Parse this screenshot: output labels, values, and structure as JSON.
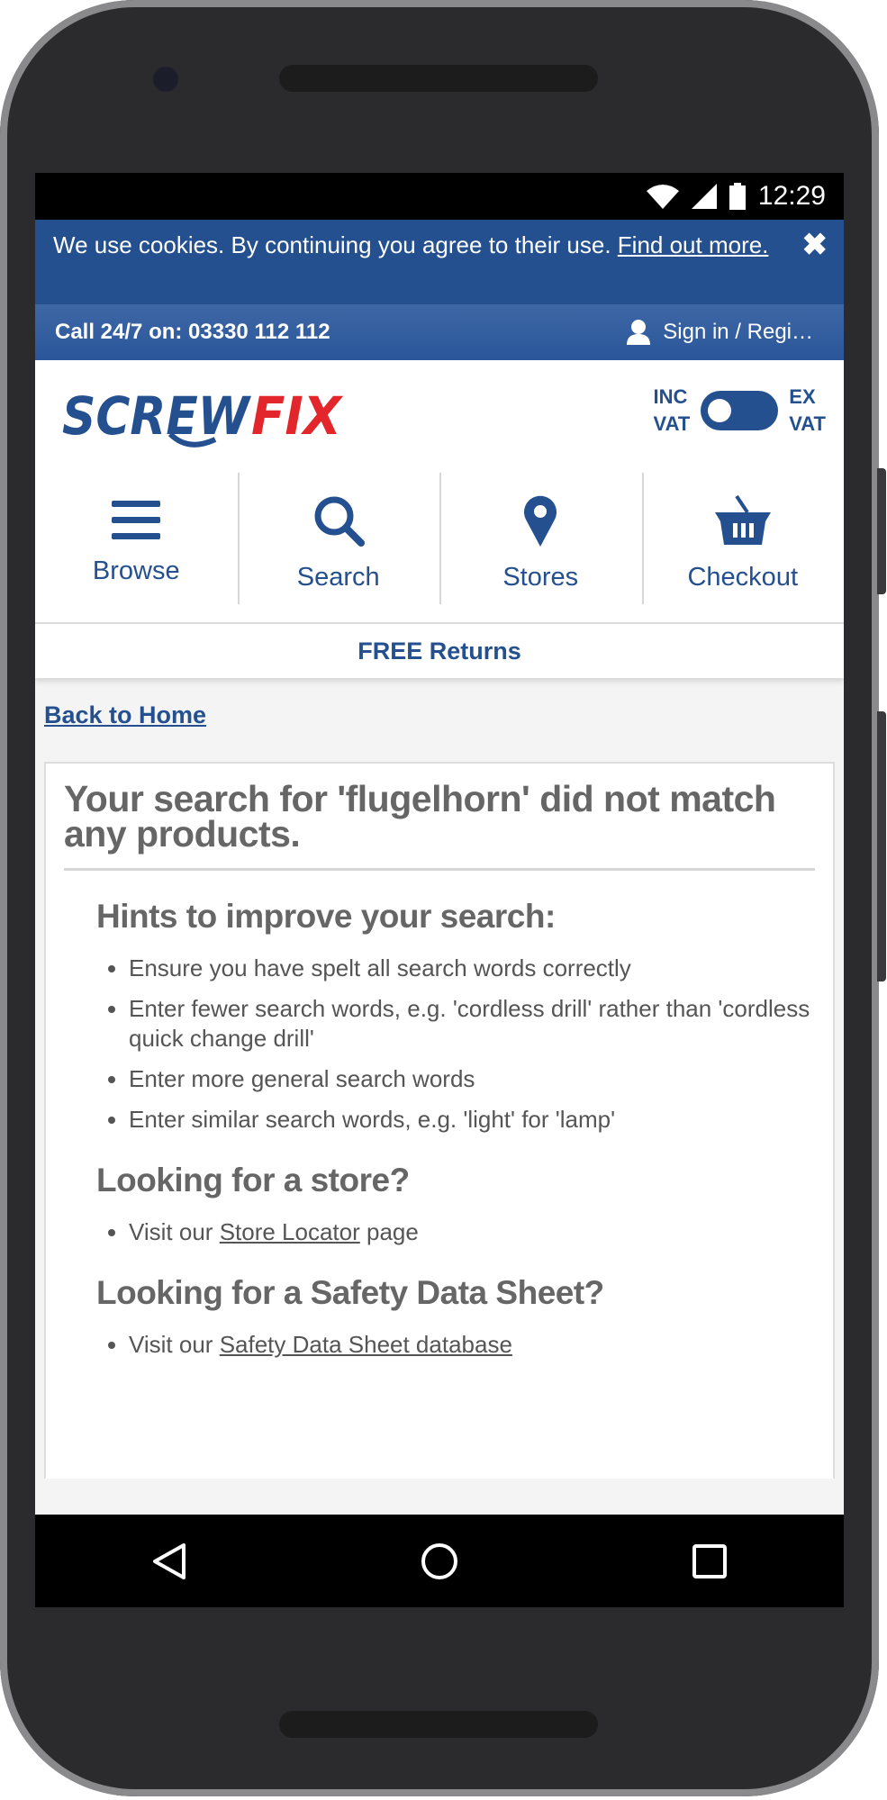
{
  "status_bar": {
    "time": "12:29"
  },
  "cookie_banner": {
    "text": "We use cookies. By continuing you agree to their use.",
    "link_text": "Find out more.",
    "close_glyph": "✖"
  },
  "call_bar": {
    "call_text": "Call 24/7 on: 03330 112 112",
    "sign_in_text": "Sign in / Regi…"
  },
  "header": {
    "logo_part1": "SCREW",
    "logo_part2": "FIX",
    "vat_inc_line1": "INC",
    "vat_inc_line2": "VAT",
    "vat_ex_line1": "EX",
    "vat_ex_line2": "VAT"
  },
  "nav": {
    "browse": "Browse",
    "search": "Search",
    "stores": "Stores",
    "checkout": "Checkout"
  },
  "promo": "FREE Returns",
  "main": {
    "back_link": "Back to Home",
    "no_results_title": "Your search for 'flugelhorn' did not match any products.",
    "hints_heading": "Hints to improve your search:",
    "hints": [
      "Ensure you have spelt all search words correctly",
      "Enter fewer search words, e.g. 'cordless drill' rather than 'cordless quick change drill'",
      "Enter more general search words",
      "Enter similar search words, e.g. 'light' for 'lamp'"
    ],
    "store_heading": "Looking for a store?",
    "store_text_before": "Visit our ",
    "store_link": "Store Locator",
    "store_text_after": " page",
    "sds_heading": "Looking for a Safety Data Sheet?",
    "sds_text_before": "Visit our ",
    "sds_link": "Safety Data Sheet database"
  },
  "colors": {
    "brand_blue": "#24508f",
    "logo_red": "#e2262c",
    "text_grey": "#666666"
  },
  "icons": {
    "browse": "hamburger-menu-icon",
    "search": "magnifier-icon",
    "stores": "map-pin-icon",
    "checkout": "basket-icon",
    "sign_in": "user-icon"
  }
}
